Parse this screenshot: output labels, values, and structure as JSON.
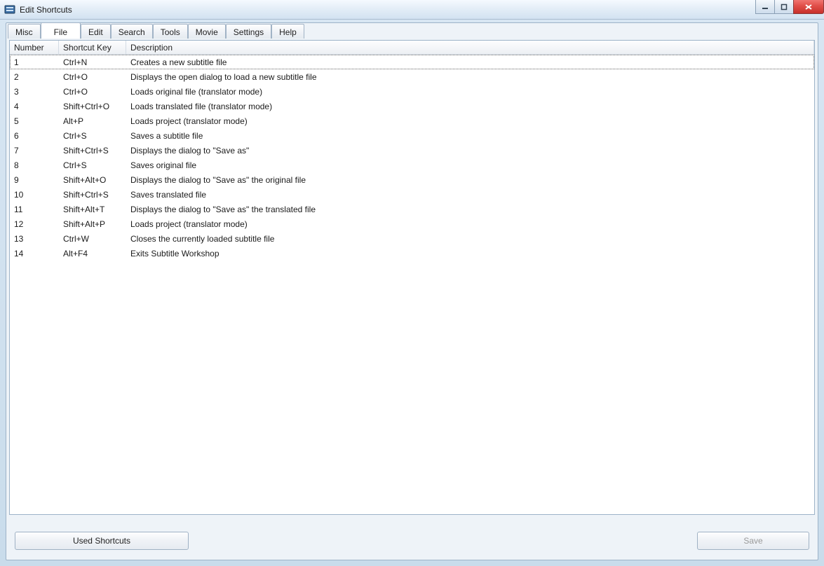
{
  "window": {
    "title": "Edit Shortcuts"
  },
  "tabs": [
    {
      "label": "Misc",
      "active": false
    },
    {
      "label": "File",
      "active": true
    },
    {
      "label": "Edit",
      "active": false
    },
    {
      "label": "Search",
      "active": false
    },
    {
      "label": "Tools",
      "active": false
    },
    {
      "label": "Movie",
      "active": false
    },
    {
      "label": "Settings",
      "active": false
    },
    {
      "label": "Help",
      "active": false
    }
  ],
  "columns": {
    "number": "Number",
    "shortcut_key": "Shortcut Key",
    "description": "Description"
  },
  "rows": [
    {
      "num": "1",
      "key": "Ctrl+N",
      "desc": "Creates a new subtitle file"
    },
    {
      "num": "2",
      "key": "Ctrl+O",
      "desc": "Displays the open dialog to load a new subtitle file"
    },
    {
      "num": "3",
      "key": "Ctrl+O",
      "desc": "Loads original file (translator mode)"
    },
    {
      "num": "4",
      "key": "Shift+Ctrl+O",
      "desc": "Loads translated file (translator mode)"
    },
    {
      "num": "5",
      "key": "Alt+P",
      "desc": "Loads project (translator mode)"
    },
    {
      "num": "6",
      "key": "Ctrl+S",
      "desc": "Saves a subtitle file"
    },
    {
      "num": "7",
      "key": "Shift+Ctrl+S",
      "desc": "Displays the dialog to \"Save as\""
    },
    {
      "num": "8",
      "key": "Ctrl+S",
      "desc": "Saves original file"
    },
    {
      "num": "9",
      "key": "Shift+Alt+O",
      "desc": "Displays the dialog to \"Save as\" the original file"
    },
    {
      "num": "10",
      "key": "Shift+Ctrl+S",
      "desc": "Saves translated file"
    },
    {
      "num": "11",
      "key": "Shift+Alt+T",
      "desc": "Displays the dialog to \"Save as\" the translated file"
    },
    {
      "num": "12",
      "key": "Shift+Alt+P",
      "desc": "Loads project (translator mode)"
    },
    {
      "num": "13",
      "key": "Ctrl+W",
      "desc": "Closes the currently loaded subtitle file"
    },
    {
      "num": "14",
      "key": "Alt+F4",
      "desc": "Exits Subtitle Workshop"
    }
  ],
  "buttons": {
    "used_shortcuts": "Used Shortcuts",
    "save": "Save"
  }
}
